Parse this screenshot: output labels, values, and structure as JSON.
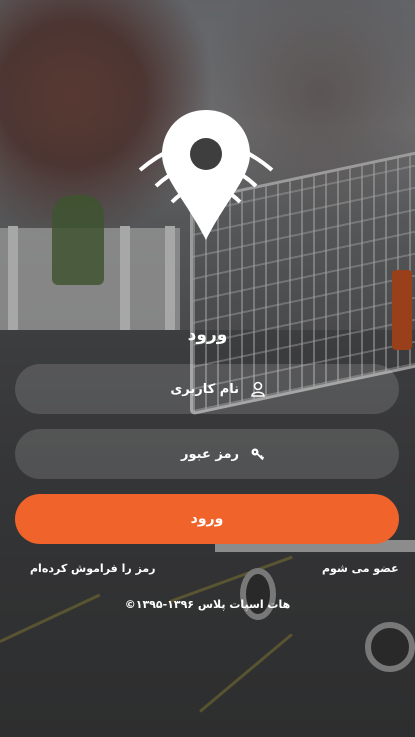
{
  "login": {
    "title": "ورود",
    "username_placeholder": "نام کاربری",
    "password_placeholder": "رمز عبور",
    "submit_label": "ورود",
    "forgot_password": "رمز را فراموش کرده‌ام",
    "register": "عضو می شوم"
  },
  "footer": {
    "copyright": "©۱۳۹۵-۱۳۹۶ هات اسپات پلاس"
  },
  "colors": {
    "accent": "#f0632a"
  },
  "icons": {
    "logo": "location-pin-wifi-icon",
    "username": "user-icon",
    "password": "key-icon"
  }
}
